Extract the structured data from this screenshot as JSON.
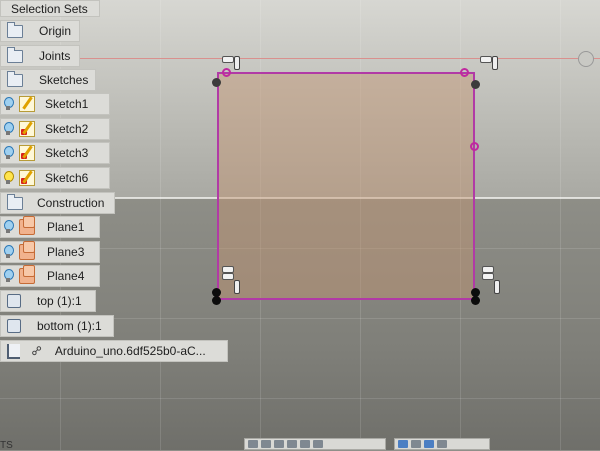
{
  "browser": {
    "items": [
      {
        "label": "Selection Sets",
        "icon": "none"
      },
      {
        "label": "Origin",
        "icon": "folder-icon"
      },
      {
        "label": "Joints",
        "icon": "folder-icon"
      },
      {
        "label": "Sketches",
        "icon": "folder-icon"
      },
      {
        "label": "Sketch1",
        "icon": "sketch-icon"
      },
      {
        "label": "Sketch2",
        "icon": "sketch-icon"
      },
      {
        "label": "Sketch3",
        "icon": "sketch-icon"
      },
      {
        "label": "Sketch6",
        "icon": "sketch-icon"
      },
      {
        "label": "Construction",
        "icon": "folder-icon"
      },
      {
        "label": "Plane1",
        "icon": "plane-icon"
      },
      {
        "label": "Plane3",
        "icon": "plane-icon"
      },
      {
        "label": "Plane4",
        "icon": "plane-icon"
      },
      {
        "label": "top (1):1",
        "icon": "body-icon"
      },
      {
        "label": "bottom (1):1",
        "icon": "body-icon"
      },
      {
        "label": "Arduino_uno.6df525b0-aC...",
        "icon": "component-icon"
      }
    ]
  },
  "statusbar": {
    "left_text": "TS"
  },
  "colors": {
    "sketch_line": "#b13aa6",
    "profile_fill": "#c49471",
    "red_axis": "#d9908e"
  }
}
